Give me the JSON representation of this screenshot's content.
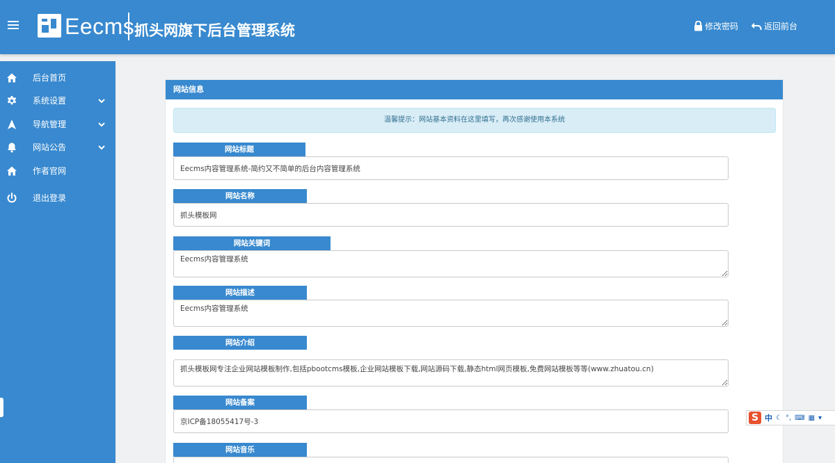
{
  "header": {
    "logo_text": "Eecms",
    "site_title": "抓头网旗下后台管理系统",
    "change_password": "修改密码",
    "back_to_front": "返回前台"
  },
  "sidebar": {
    "items": [
      {
        "label": "后台首页",
        "icon": "home-icon"
      },
      {
        "label": "系统设置",
        "icon": "gear-icon",
        "expandable": true
      },
      {
        "label": "导航管理",
        "icon": "navigation-arrow-icon",
        "expandable": true
      },
      {
        "label": "网站公告",
        "icon": "bell-icon",
        "expandable": true
      },
      {
        "label": "作者官网",
        "icon": "home-icon"
      },
      {
        "label": "退出登录",
        "icon": "power-icon"
      }
    ]
  },
  "panel": {
    "title": "网站信息",
    "notice": "温馨提示：网站基本资料在这里填写，再次感谢使用本系统"
  },
  "form": {
    "site_title": {
      "label": "网站标题",
      "value": "Eecms内容管理系统-简约又不简单的后台内容管理系统"
    },
    "site_name": {
      "label": "网站名称",
      "value": "抓头模板网"
    },
    "site_keywords": {
      "label": "网站关键词",
      "value": "Eecms内容管理系统"
    },
    "site_description": {
      "label": "网站描述",
      "value": "Eecms内容管理系统"
    },
    "site_intro": {
      "label": "网站介绍",
      "value": "抓头模板网专注企业网站模板制作,包括pbootcms模板,企业网站模板下载,网站源码下载,静态html网页模板,免费网站模板等等(www.zhuatou.cn)"
    },
    "site_icp": {
      "label": "网站备案",
      "value": "京ICP备18055417号-3"
    },
    "site_music": {
      "label": "网站音乐",
      "value": ""
    }
  },
  "ime": {
    "mode": "中",
    "colors": {
      "accent": "#3889cf",
      "ime_logo": "#e8512d"
    }
  }
}
